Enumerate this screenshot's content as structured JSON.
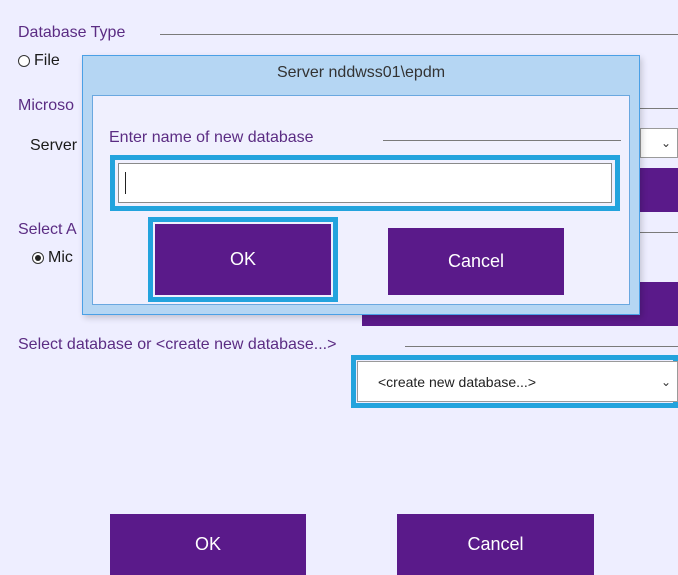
{
  "database_type": {
    "section_label": "Database Type",
    "option_file_label": "File"
  },
  "microsoft_section": {
    "label": "Microso",
    "server_label": "Server"
  },
  "select_auth": {
    "label": "Select A",
    "option_label": "Mic"
  },
  "select_database": {
    "section_label": "Select database or <create new database...>",
    "selected_value": "<create new database...>"
  },
  "main_buttons": {
    "ok_label": "OK",
    "cancel_label": "Cancel"
  },
  "dialog": {
    "title": "Server nddwss01\\epdm",
    "prompt_label": "Enter name of new database",
    "input_value": "",
    "ok_label": "OK",
    "cancel_label": "Cancel"
  },
  "colors": {
    "background": "#eeeeff",
    "accent_purple": "#5a1a8a",
    "highlight_blue": "#23a3dd",
    "dialog_frame": "#b5d6f3"
  },
  "icons": {
    "dropdown": "chevron-down-icon",
    "radio": "radio-button-icon"
  }
}
